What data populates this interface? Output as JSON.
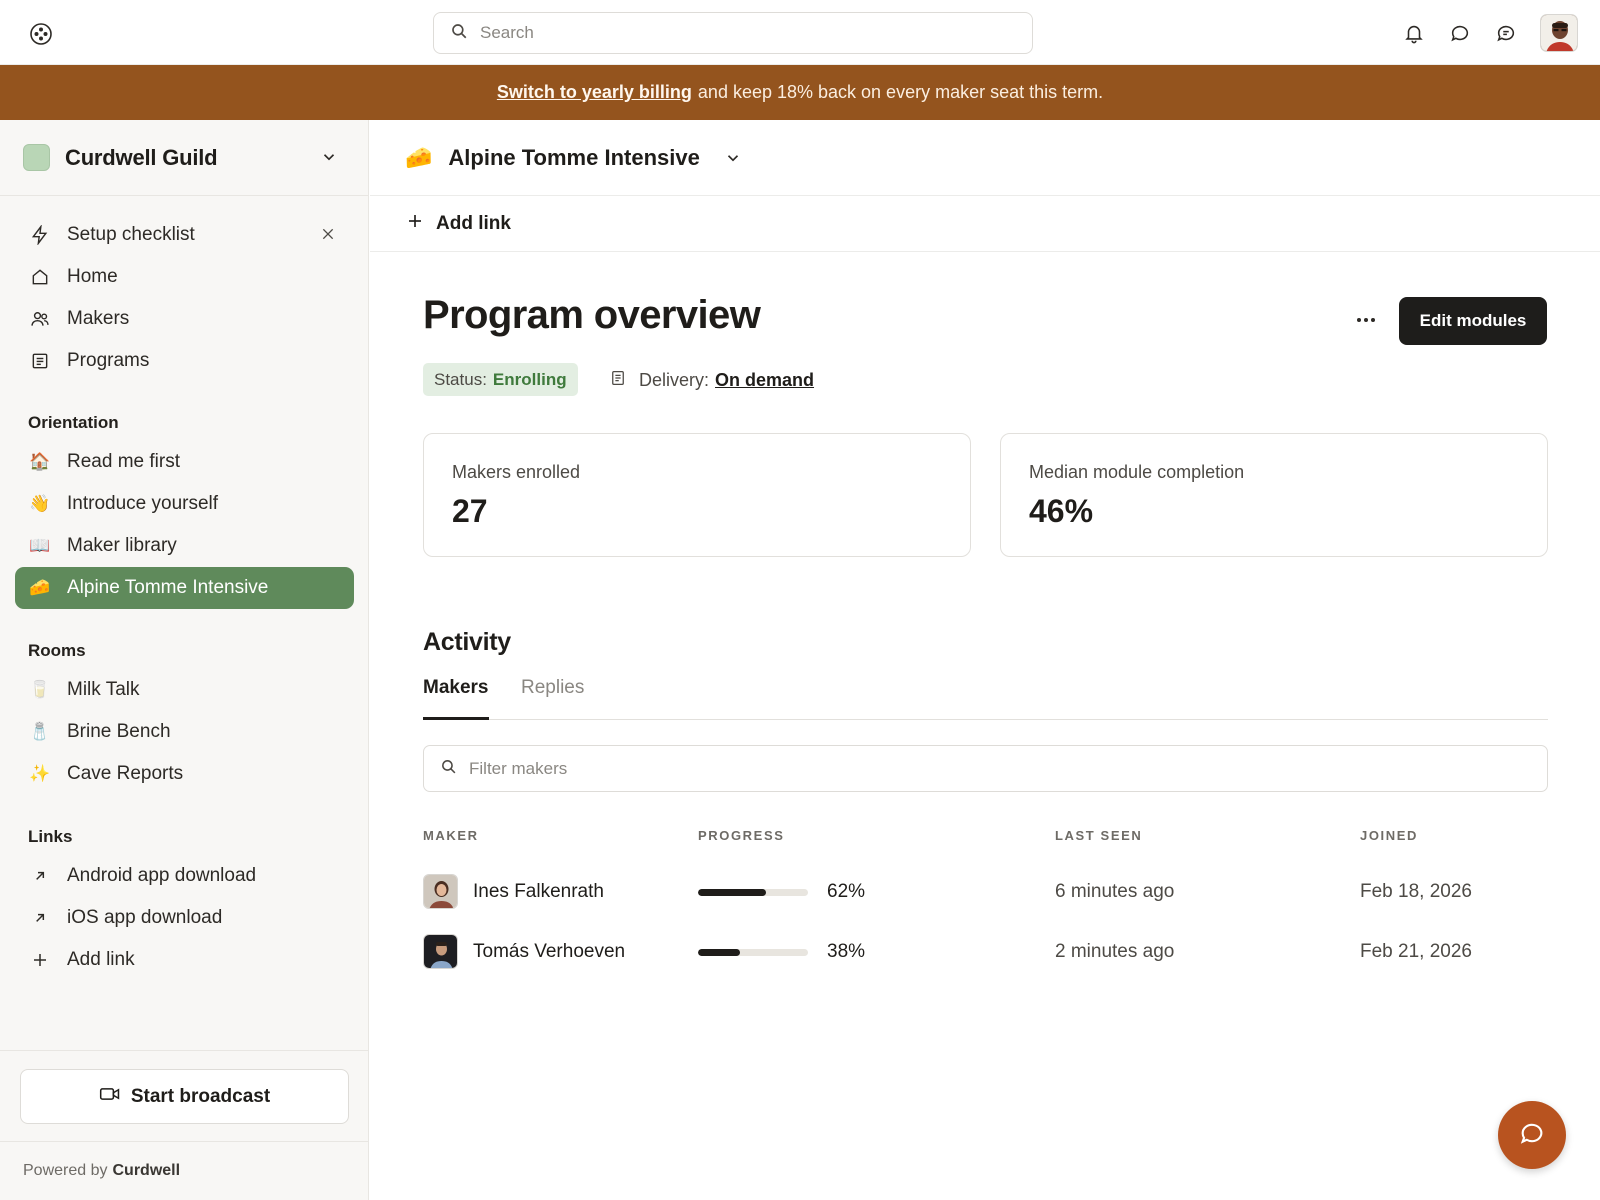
{
  "search": {
    "placeholder": "Search"
  },
  "banner": {
    "link_text": "Switch to yearly billing",
    "rest_text": "and keep 18% back on every maker seat this term."
  },
  "workspace": {
    "name": "Curdwell Guild"
  },
  "sidebar": {
    "top_items": [
      {
        "label": "Setup checklist",
        "icon": "bolt-icon"
      },
      {
        "label": "Home",
        "icon": "home-icon"
      },
      {
        "label": "Makers",
        "icon": "users-icon"
      },
      {
        "label": "Programs",
        "icon": "list-icon"
      }
    ],
    "orientation_title": "Orientation",
    "orientation_items": [
      {
        "label": "Read me first",
        "emoji": "🏠"
      },
      {
        "label": "Introduce yourself",
        "emoji": "👋"
      },
      {
        "label": "Maker library",
        "emoji": "📖"
      },
      {
        "label": "Alpine Tomme Intensive",
        "emoji": "🧀"
      }
    ],
    "rooms_title": "Rooms",
    "rooms_items": [
      {
        "label": "Milk Talk",
        "emoji": "🥛"
      },
      {
        "label": "Brine Bench",
        "emoji": "🧂"
      },
      {
        "label": "Cave Reports",
        "emoji": "✨"
      }
    ],
    "links_title": "Links",
    "links_items": [
      {
        "label": "Android app download",
        "icon": "arrow-up-right-icon"
      },
      {
        "label": "iOS app download",
        "icon": "arrow-up-right-icon"
      },
      {
        "label": "Add link",
        "icon": "plus-icon"
      }
    ],
    "broadcast_label": "Start broadcast",
    "powered_prefix": "Powered by",
    "powered_brand": "Curdwell"
  },
  "course": {
    "emoji": "🧀",
    "title": "Alpine Tomme Intensive",
    "add_link": "Add link"
  },
  "overview": {
    "title": "Program overview",
    "edit_button": "Edit modules",
    "status_label": "Status:",
    "status_value": "Enrolling",
    "delivery_label": "Delivery:",
    "delivery_value": "On demand"
  },
  "stats": [
    {
      "label": "Makers enrolled",
      "value": "27"
    },
    {
      "label": "Median module completion",
      "value": "46%"
    }
  ],
  "activity": {
    "title": "Activity",
    "tabs": [
      "Makers",
      "Replies"
    ],
    "filter_placeholder": "Filter makers",
    "columns": [
      "MAKER",
      "PROGRESS",
      "LAST SEEN",
      "JOINED"
    ],
    "rows": [
      {
        "name": "Ines Falkenrath",
        "progress": 62,
        "progress_label": "62%",
        "last_seen": "6 minutes ago",
        "joined": "Feb 18, 2026"
      },
      {
        "name": "Tomás Verhoeven",
        "progress": 38,
        "progress_label": "38%",
        "last_seen": "2 minutes ago",
        "joined": "Feb 21, 2026"
      }
    ]
  },
  "colors": {
    "banner": "#94541e",
    "active_nav": "#5f8a5b",
    "status_green": "#3f7a3c",
    "fab": "#b8531f"
  }
}
